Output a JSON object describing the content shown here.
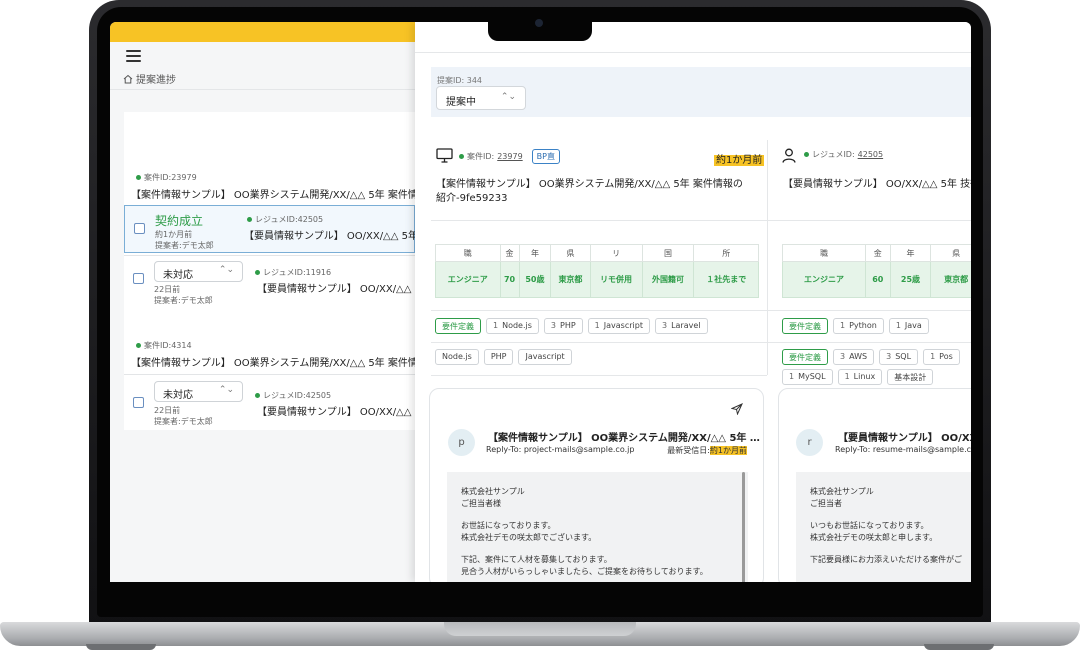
{
  "breadcrumb": {
    "label": "提案進捗"
  },
  "list": {
    "groups": [
      {
        "project_id": "案件ID:23979",
        "project_title": "【案件情報サンプル】 OO業界システム開発/XX/△△ 5年 案件情",
        "rows": [
          {
            "status": "契約成立",
            "date": "約1か月前",
            "proposer": "提案者:デモ太郎",
            "resume_id": "レジュメID:42505",
            "resume_title": "【要員情報サンプル】 OO/XX/△△ 5年"
          },
          {
            "status": "未対応",
            "date": "22日前",
            "proposer": "提案者:デモ太郎",
            "resume_id": "レジュメID:11916",
            "resume_title": "【要員情報サンプル】 OO/XX/△△ 5年"
          }
        ]
      },
      {
        "project_id": "案件ID:4314",
        "project_title": "【案件情報サンプル】 OO業界システム開発/XX/△△ 5年 案件情",
        "rows": [
          {
            "status": "未対応",
            "date": "22日前",
            "proposer": "提案者:デモ太郎",
            "resume_id": "レジュメID:42505",
            "resume_title": "【要員情報サンプル】 OO/XX/△△ 5年"
          }
        ]
      }
    ]
  },
  "detail": {
    "proposal_id": "提案ID: 344",
    "status": "提案中",
    "project": {
      "id_label": "案件ID:",
      "id": "23979",
      "badge": "BP直",
      "age": "約1か月前",
      "title": "【案件情報サンプル】 OO業界システム開発/XX/△△ 5年 案件情報の紹介-9fe59233",
      "table_headers": [
        "職",
        "金",
        "年",
        "県",
        "リ",
        "国",
        "所"
      ],
      "table_values": [
        "エンジニア",
        "70",
        "50歳",
        "東京都",
        "リモ併用",
        "外国籍可",
        "１社先まで"
      ],
      "tags": [
        {
          "label": "要件定義",
          "n": ""
        },
        {
          "label": "Node.js",
          "n": "1"
        },
        {
          "label": "PHP",
          "n": "3"
        },
        {
          "label": "Javascript",
          "n": "1"
        },
        {
          "label": "Laravel",
          "n": "3"
        }
      ],
      "tags2": [
        "Node.js",
        "PHP",
        "Javascript"
      ]
    },
    "resume": {
      "id_label": "レジュメID:",
      "id": "42505",
      "title": "【要員情報サンプル】 OO/XX/△△ 5年 技術",
      "table_headers": [
        "職",
        "金",
        "年",
        "県"
      ],
      "table_values": [
        "エンジニア",
        "60",
        "25歳",
        "東京都"
      ],
      "tags": [
        {
          "label": "要件定義",
          "n": ""
        },
        {
          "label": "Python",
          "n": "1"
        },
        {
          "label": "Java",
          "n": "1"
        }
      ],
      "tags2": [
        {
          "label": "要件定義",
          "n": ""
        },
        {
          "label": "AWS",
          "n": "3"
        },
        {
          "label": "SQL",
          "n": "3"
        },
        {
          "label": "Pos",
          "n": "1"
        },
        {
          "label": "MySQL",
          "n": "1"
        },
        {
          "label": "Linux",
          "n": "1"
        },
        {
          "label": "基本設計",
          "n": ""
        }
      ]
    },
    "mail_project": {
      "avatar": "p",
      "title": "【案件情報サンプル】 OO業界システム開発/XX/△△ 5年 …",
      "reply_to": "Reply-To: project-mails@sample.co.jp",
      "received_label": "最新受信日:",
      "received": "約1か月前",
      "body": [
        "株式会社サンプル",
        "ご担当者様",
        "お世話になっております。",
        "株式会社デモの咲太郎でございます。",
        "下記、案件にて人材を募集しております。",
        "見合う人材がいらっしゃいましたら、ご提案をお待ちしております。"
      ]
    },
    "mail_resume": {
      "avatar": "r",
      "title": "【要員情報サンプル】 OO/XX/△",
      "reply_to": "Reply-To: resume-mails@sample.co",
      "body": [
        "株式会社サンプル",
        "ご担当者",
        "いつもお世話になっております。",
        "株式会社デモの咲太郎と申します。",
        "下記要員様にお力添えいただける案件がご"
      ]
    }
  }
}
